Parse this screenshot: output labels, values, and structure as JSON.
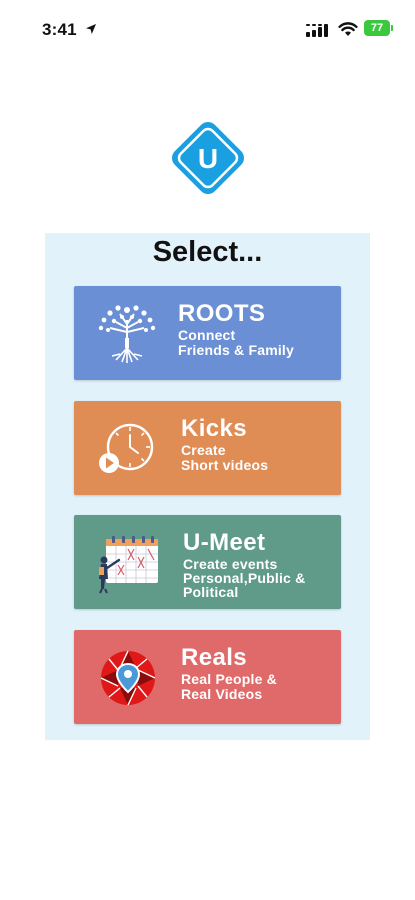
{
  "status_bar": {
    "time": "3:41",
    "battery": "77",
    "icons": [
      "location-arrow-icon",
      "cellular-signal-icon",
      "wifi-icon",
      "battery-icon"
    ],
    "battery_color": "#3cc83c"
  },
  "logo": {
    "letter": "U",
    "color": "#1aa0e0"
  },
  "panel": {
    "title": "Select...",
    "background": "#e2f2fb"
  },
  "options": [
    {
      "title": "ROOTS",
      "subtitle_line1": "Connect",
      "subtitle_line2": "Friends & Family",
      "icon": "tree-icon",
      "color": "#6b8fd4"
    },
    {
      "title": "Kicks",
      "subtitle_line1": "Create",
      "subtitle_line2": "Short videos",
      "icon": "clock-play-icon",
      "color": "#e08c55"
    },
    {
      "title": "U-Meet",
      "subtitle_line1": "Create events",
      "subtitle_line2": "Personal,Public &",
      "subtitle_line3": "Political",
      "icon": "calendar-person-icon",
      "color": "#5f9b88"
    },
    {
      "title": "Reals",
      "subtitle_line1": "Real People &",
      "subtitle_line2": "Real Videos",
      "icon": "camera-shutter-pin-icon",
      "color": "#e06a6a"
    }
  ]
}
